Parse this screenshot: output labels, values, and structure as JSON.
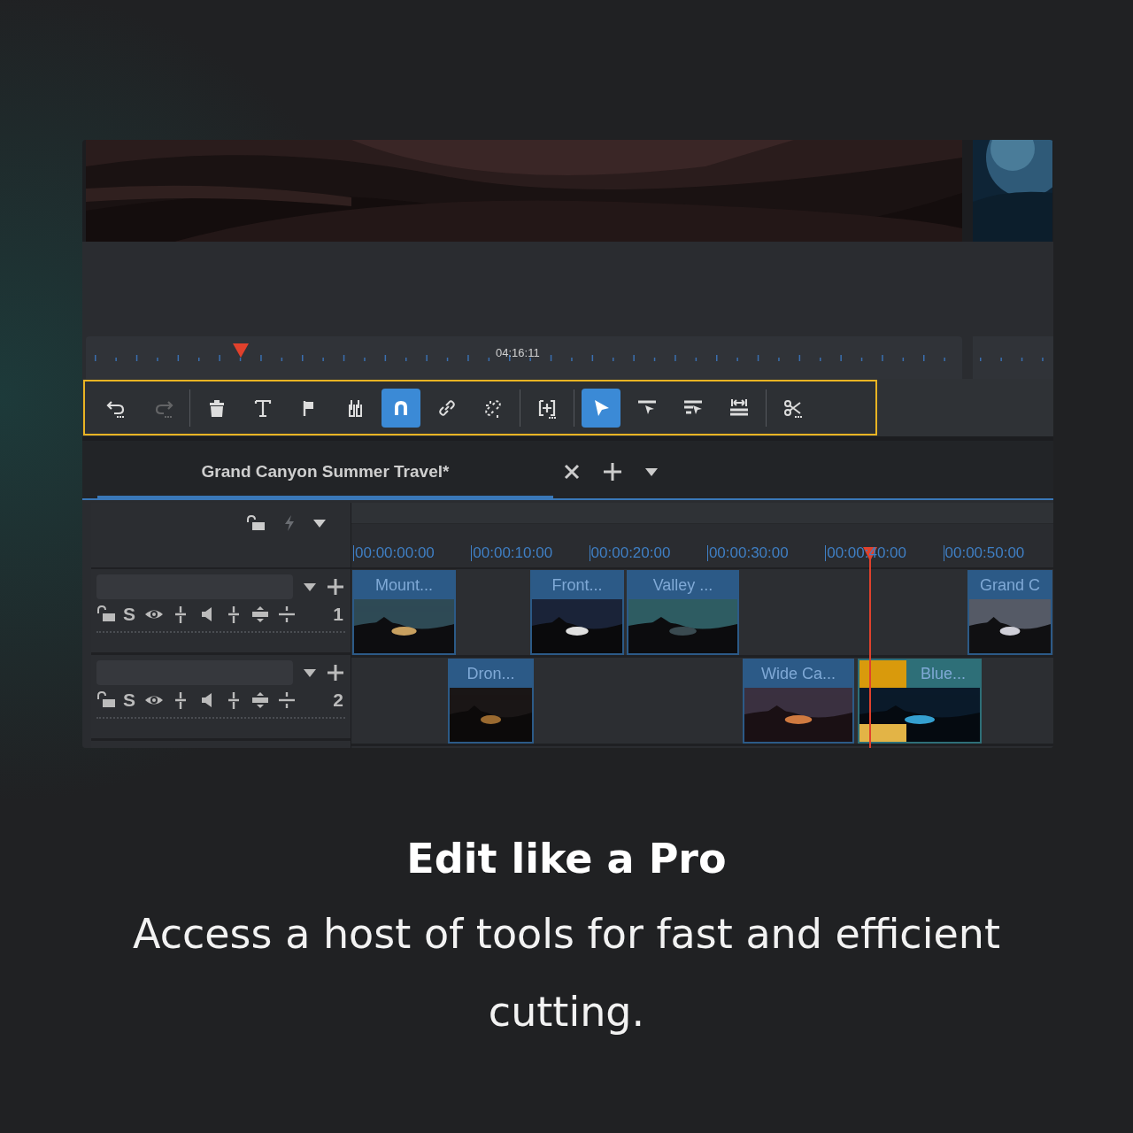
{
  "preview": {
    "timecode": "04:16:11"
  },
  "toolbar": {
    "groups": [
      [
        {
          "kind": "undo",
          "selected": false,
          "disabled": false
        },
        {
          "kind": "redo",
          "selected": false,
          "disabled": true
        }
      ],
      [
        {
          "kind": "delete",
          "selected": false,
          "disabled": false
        },
        {
          "kind": "text",
          "selected": false,
          "disabled": false
        },
        {
          "kind": "marker",
          "selected": false,
          "disabled": false
        },
        {
          "kind": "mixer",
          "selected": false,
          "disabled": false
        },
        {
          "kind": "snap",
          "selected": true,
          "disabled": false
        },
        {
          "kind": "link",
          "selected": false,
          "disabled": false
        },
        {
          "kind": "unlink",
          "selected": false,
          "disabled": false
        }
      ],
      [
        {
          "kind": "insert",
          "selected": false,
          "disabled": false
        }
      ],
      [
        {
          "kind": "select",
          "selected": true,
          "disabled": false
        },
        {
          "kind": "ripple",
          "selected": false,
          "disabled": false
        },
        {
          "kind": "roll",
          "selected": false,
          "disabled": false
        },
        {
          "kind": "stretch",
          "selected": false,
          "disabled": false
        }
      ],
      [
        {
          "kind": "razor",
          "selected": false,
          "disabled": false
        }
      ]
    ]
  },
  "tabs": [
    {
      "title": "Grand Canyon Summer Travel*",
      "selected": true
    }
  ],
  "timeline": {
    "ruler_labels": [
      "00:00:00:00",
      "00:00:10:00",
      "00:00:20:00",
      "00:00:30:00",
      "00:00:40:00",
      "00:00:50:00"
    ],
    "tracks": [
      {
        "number": "1",
        "solo": "S",
        "clips": [
          {
            "title": "Mount...",
            "color": "#2c5a87",
            "transition": false
          },
          {
            "title": "Front...",
            "color": "#2c5a87",
            "transition": false
          },
          {
            "title": "Valley ...",
            "color": "#2c5a87",
            "transition": false
          },
          {
            "title": "Grand C",
            "color": "#2c5a87",
            "transition": false
          }
        ]
      },
      {
        "number": "2",
        "solo": "S",
        "clips": [
          {
            "title": "Dron...",
            "color": "#2c5a87",
            "transition": false
          },
          {
            "title": "Wide Ca...",
            "color": "#2c5a87",
            "transition": false
          },
          {
            "title": "Blue...",
            "color": "#2e6f78",
            "transition": true
          }
        ]
      }
    ]
  },
  "caption": {
    "heading": "Edit like a Pro",
    "text": "Access a host of tools for fast and efficient cutting."
  }
}
